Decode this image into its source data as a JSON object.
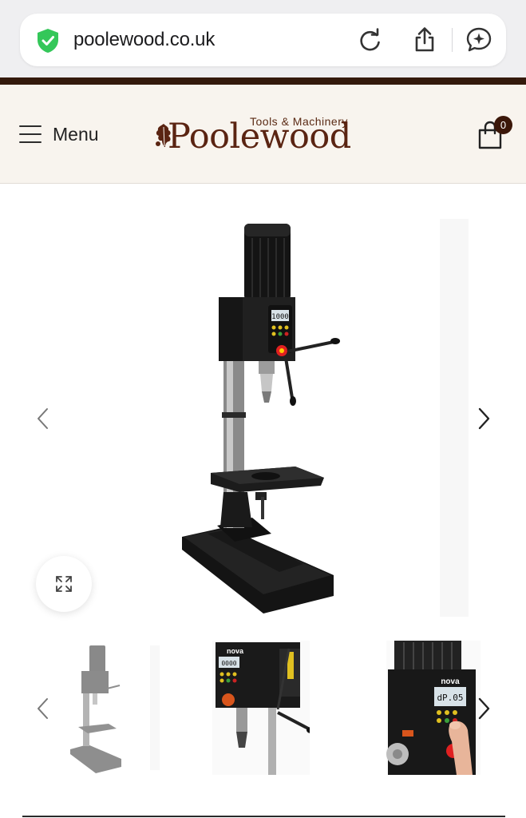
{
  "browser": {
    "url": "poolewood.co.uk"
  },
  "header": {
    "menu_label": "Menu",
    "logo_name": "Poolewood",
    "logo_tagline": "Tools & Machinery",
    "cart_count": "0"
  },
  "gallery": {
    "main_display": "1000",
    "thumb2_display": "0000",
    "thumb3_display": "dP.05",
    "thumb_brand": "nova",
    "main_brand": "nova"
  },
  "colors": {
    "brand_brown": "#5a2412",
    "strip": "#341a0c",
    "header_bg": "#f8f4ee"
  }
}
